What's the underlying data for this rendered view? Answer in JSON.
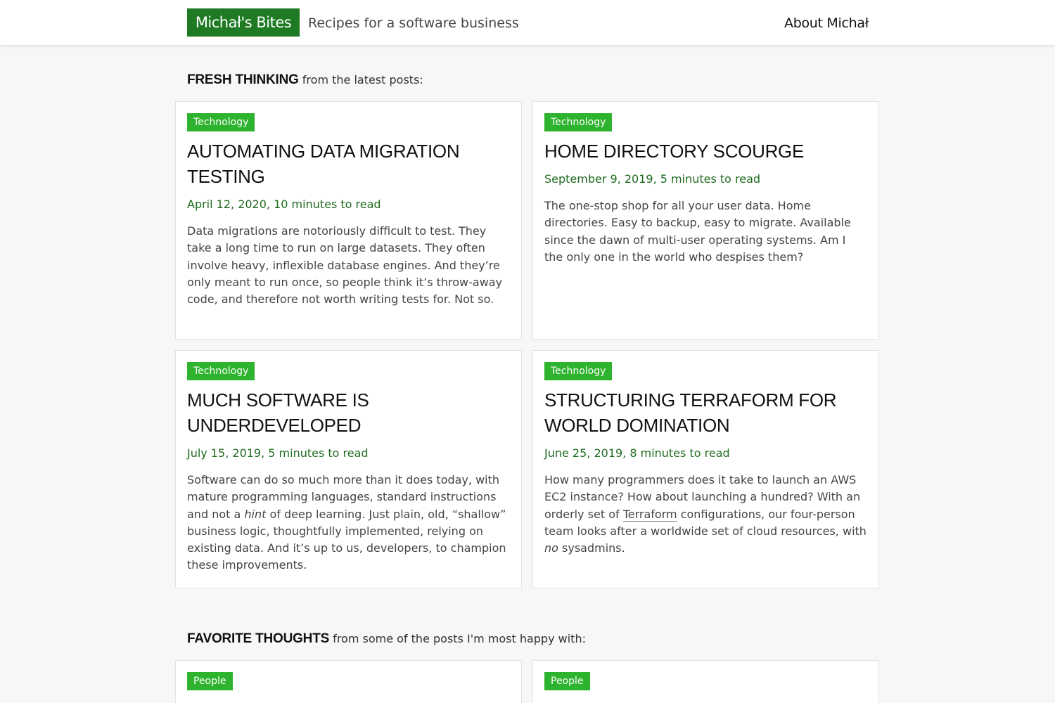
{
  "header": {
    "logo": "Michał's Bites",
    "tagline": "Recipes for a software business",
    "about_link": "About Michał"
  },
  "fresh": {
    "heading_strong": "FRESH THINKING",
    "heading_rest": " from the latest posts:",
    "posts": [
      {
        "tag": "Technology",
        "title": "Automating Data Migration Testing",
        "meta": "April 12, 2020, 10 minutes to read",
        "excerpt": "Data migrations are notoriously difficult to test. They take a long time to run on large datasets. They often involve heavy, inflexible database engines. And they’re only meant to run once, so people think it’s throw-away code, and therefore not worth writing tests for. Not so."
      },
      {
        "tag": "Technology",
        "title": "Home Directory Scourge",
        "meta": "September 9, 2019, 5 minutes to read",
        "excerpt": "The one-stop shop for all your user data. Home directories. Easy to backup, easy to migrate. Available since the dawn of multi-user operating systems. Am I the only one in the world who despises them?"
      },
      {
        "tag": "Technology",
        "title": "Much Software is Underdeveloped",
        "meta": "July 15, 2019, 5 minutes to read",
        "excerpt_a": "Software can do so much more than it does today, with mature programming languages, standard instructions and not a ",
        "excerpt_em": "hint",
        "excerpt_b": " of deep learning. Just plain, old, “shallow” business logic, thoughtfully implemented, relying on existing data. And it’s up to us, developers, to champion these improvements."
      },
      {
        "tag": "Technology",
        "title": "Structuring Terraform for World Domination",
        "meta": "June 25, 2019, 8 minutes to read",
        "excerpt_a": "How many programmers does it take to launch an AWS EC2 instance? How about launching a hundred? With an orderly set of ",
        "excerpt_link": "Terraform",
        "excerpt_b": " configurations, our four-person team looks after a worldwide set of cloud resources, with ",
        "excerpt_em": "no",
        "excerpt_c": " sysadmins."
      }
    ]
  },
  "favorite": {
    "heading_strong": "FAVORITE THOUGHTS",
    "heading_rest": " from some of the posts I'm most happy with:",
    "posts": [
      {
        "tag": "People"
      },
      {
        "tag": "People"
      }
    ]
  },
  "colors": {
    "logo_bg": "#1e7a23",
    "tag_bg": "#2db32d",
    "meta_text": "#1f6b1f",
    "page_bg": "#f7f7f7"
  }
}
